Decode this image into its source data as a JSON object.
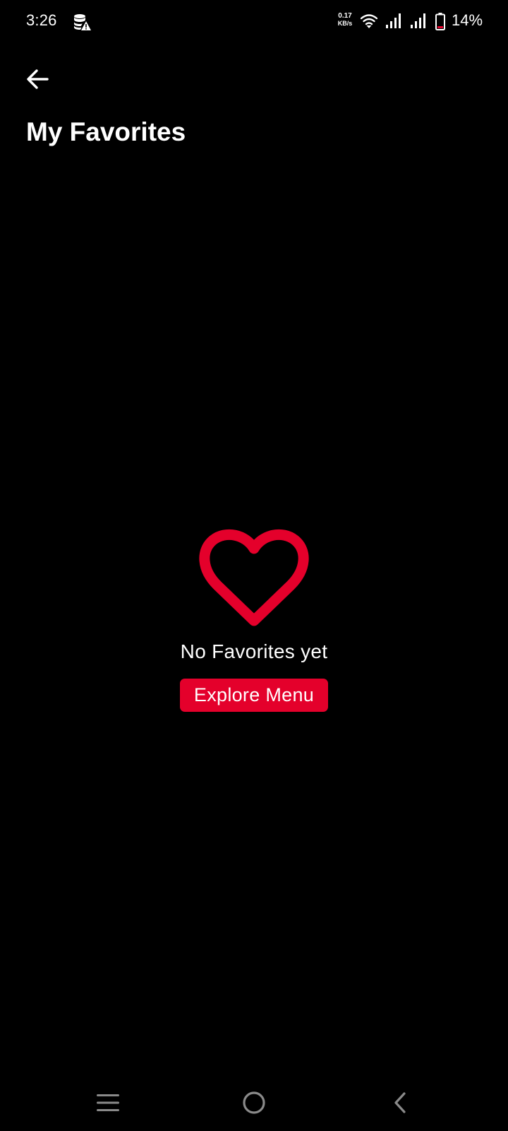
{
  "status_bar": {
    "time": "3:26",
    "net_speed_value": "0.17",
    "net_speed_unit": "KB/s",
    "battery": "14%"
  },
  "header": {
    "title": "My Favorites"
  },
  "empty_state": {
    "message": "No Favorites yet",
    "button_label": "Explore Menu"
  },
  "colors": {
    "background": "#000000",
    "accent": "#e4002b",
    "text": "#ffffff"
  },
  "icons": {
    "back": "back-arrow-icon",
    "heart": "heart-outline-icon",
    "nav_menu": "menu-lines-icon",
    "nav_home": "home-circle-icon",
    "nav_back": "chevron-left-icon"
  }
}
